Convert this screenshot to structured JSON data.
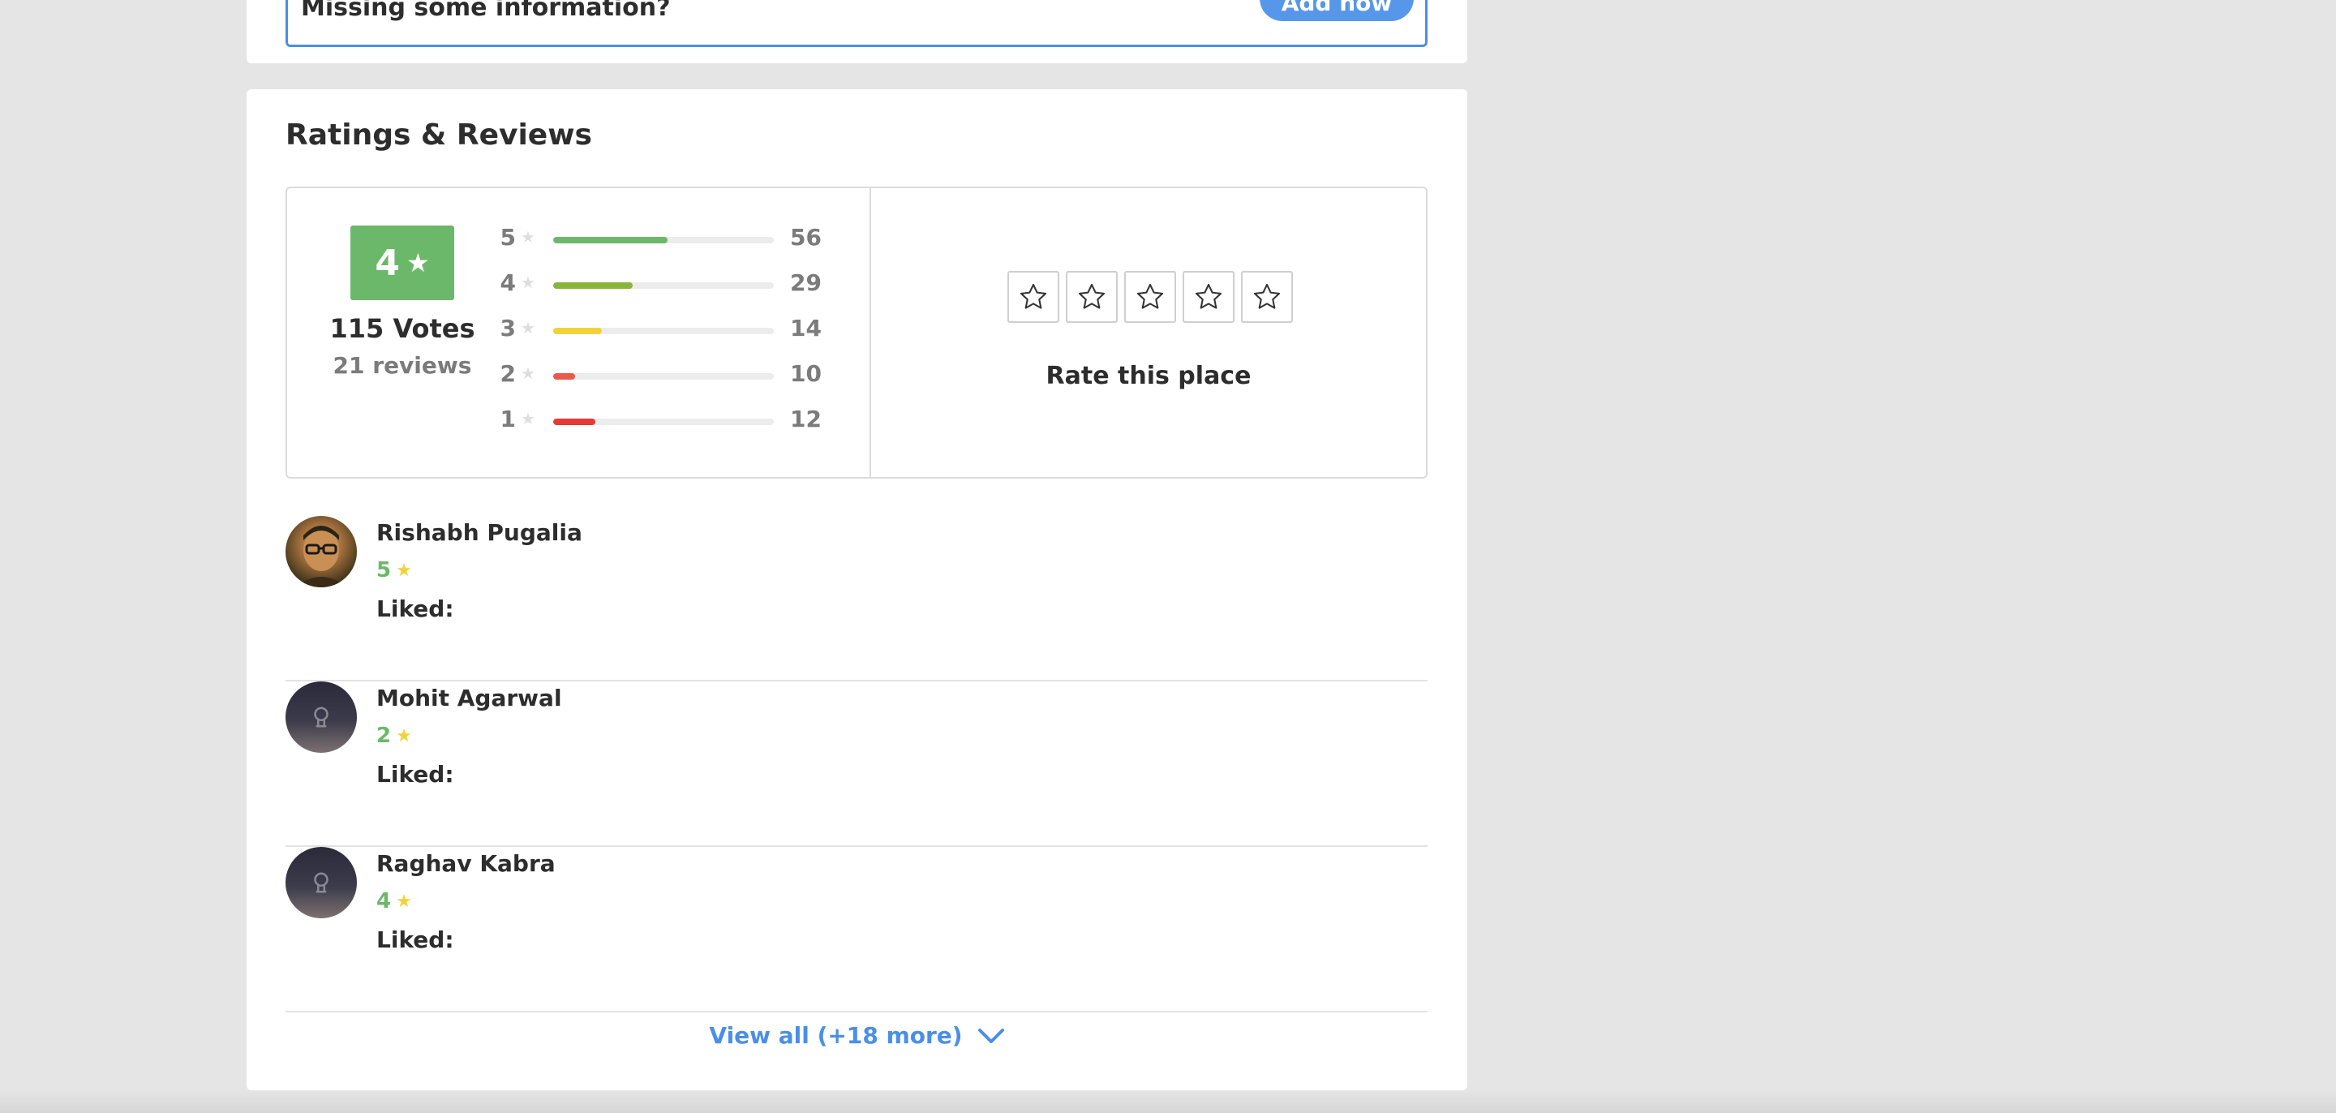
{
  "missing_info": {
    "text": "Missing some information?",
    "button_label": "Add now"
  },
  "section_title": "Ratings & Reviews",
  "summary": {
    "score": "4",
    "votes": "115 Votes",
    "reviews": "21 reviews"
  },
  "distribution": [
    {
      "stars": "5",
      "count": "56",
      "fraction": 0.52,
      "color": "#6cb86a"
    },
    {
      "stars": "4",
      "count": "29",
      "fraction": 0.36,
      "color": "#8ab53c"
    },
    {
      "stars": "3",
      "count": "14",
      "fraction": 0.22,
      "color": "#f2d23a"
    },
    {
      "stars": "2",
      "count": "10",
      "fraction": 0.1,
      "color": "#ea5a4a"
    },
    {
      "stars": "1",
      "count": "12",
      "fraction": 0.19,
      "color": "#e53b35"
    }
  ],
  "rate_this_place": {
    "label": "Rate this place",
    "star_count": 5
  },
  "reviews": [
    {
      "name": "Rishabh Pugalia",
      "rating": "5",
      "liked_label": "Liked:",
      "avatar": "photo"
    },
    {
      "name": "Mohit Agarwal",
      "rating": "2",
      "liked_label": "Liked:",
      "avatar": "default"
    },
    {
      "name": "Raghav Kabra",
      "rating": "4",
      "liked_label": "Liked:",
      "avatar": "default"
    }
  ],
  "view_all_label": "View all (+18 more)",
  "colors": {
    "accent_blue": "#4a8fe7",
    "rating_green": "#6cb86a",
    "star_yellow": "#f2d23a"
  }
}
